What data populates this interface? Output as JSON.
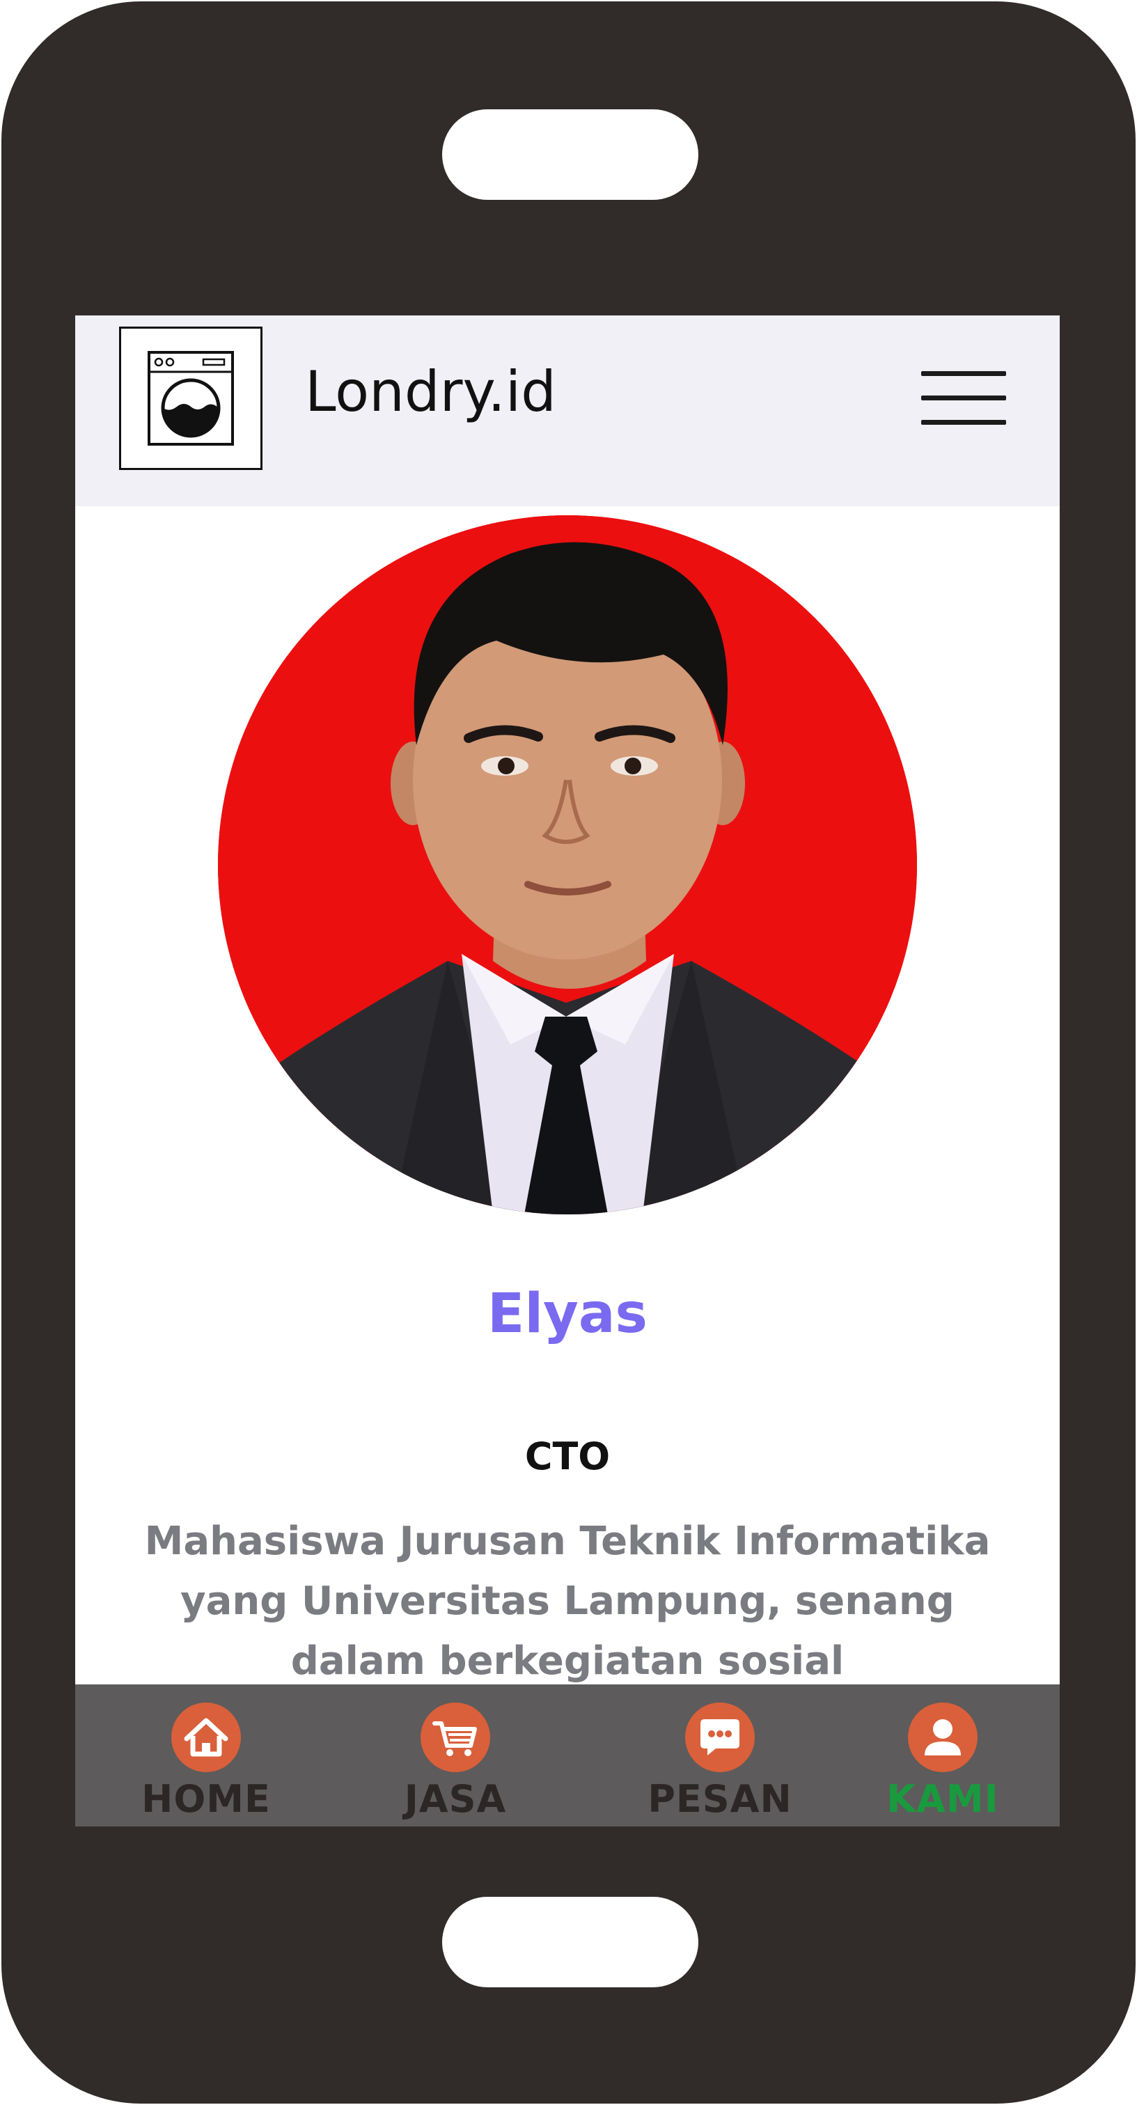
{
  "header": {
    "brand": "Londry.id",
    "logo_icon": "washing-machine-icon",
    "menu_icon": "hamburger-menu-icon",
    "background": "#f0f0f6"
  },
  "profile": {
    "name": "Elyas",
    "role": "CTO",
    "description": "Mahasiswa Jurusan Teknik Informatika yang Universitas Lampung, senang dalam berkegiatan sosial",
    "photo_background": "#ec0f10",
    "name_color": "#7a6af0"
  },
  "bottom_nav": {
    "items": [
      {
        "label": "HOME",
        "icon": "home-icon",
        "active": false
      },
      {
        "label": "JASA",
        "icon": "cart-icon",
        "active": false
      },
      {
        "label": "PESAN",
        "icon": "chat-icon",
        "active": false
      },
      {
        "label": "KAMI",
        "icon": "user-icon",
        "active": true
      }
    ],
    "background": "#5d5b5b",
    "icon_color": "#d9603a",
    "active_color": "#1a9a3e"
  }
}
